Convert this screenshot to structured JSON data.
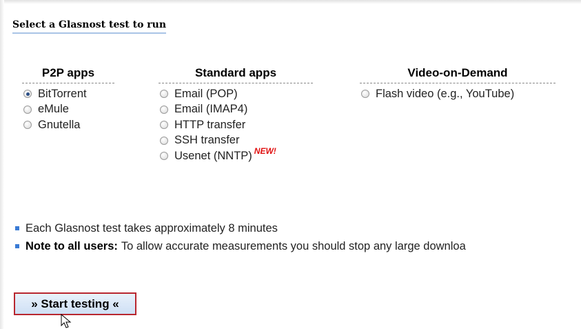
{
  "section_title": "Select a Glasnost test to run",
  "columns": [
    {
      "heading": "P2P apps",
      "options": [
        {
          "label": "BitTorrent",
          "checked": true
        },
        {
          "label": "eMule",
          "checked": false
        },
        {
          "label": "Gnutella",
          "checked": false
        }
      ]
    },
    {
      "heading": "Standard apps",
      "options": [
        {
          "label": "Email (POP)",
          "checked": false
        },
        {
          "label": "Email (IMAP4)",
          "checked": false
        },
        {
          "label": "HTTP transfer",
          "checked": false
        },
        {
          "label": "SSH transfer",
          "checked": false
        },
        {
          "label": "Usenet (NNTP)",
          "checked": false,
          "badge": "NEW!"
        }
      ]
    },
    {
      "heading": "Video-on-Demand",
      "options": [
        {
          "label": "Flash video (e.g., YouTube)",
          "checked": false
        }
      ]
    }
  ],
  "notes": [
    {
      "bold": "",
      "text": "Each Glasnost test takes approximately 8 minutes"
    },
    {
      "bold": "Note to all users:",
      "text": "To allow accurate measurements you should stop any large downloa"
    }
  ],
  "start_button": {
    "label": "» Start testing «"
  },
  "colors": {
    "bullet": "#3a7bd5",
    "button_border": "#b8262f",
    "new_badge": "#e01010",
    "title_underline": "#a9c4e6"
  }
}
